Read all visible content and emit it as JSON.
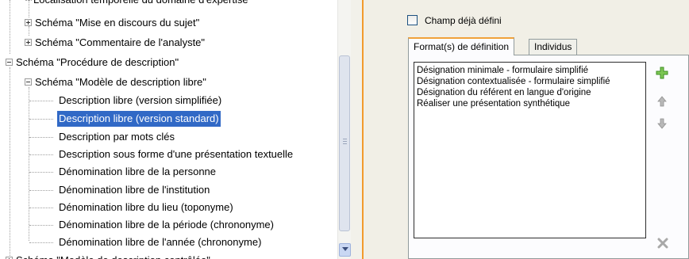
{
  "tree": {
    "top_cut_text": "Localisation temporelle du domaine d'expertise",
    "nodes": [
      {
        "label": "Schéma \"Mise en discours du sujet\"",
        "expander": "plus"
      },
      {
        "label": "Schéma \"Commentaire de l'analyste\"",
        "expander": "plus"
      },
      {
        "label": "Schéma \"Procédure de description\"",
        "expander": "minus"
      },
      {
        "label": "Schéma \"Modèle de description libre\"",
        "expander": "minus"
      },
      {
        "label": "Description libre (version simplifiée)"
      },
      {
        "label": "Description libre (version standard)",
        "selected": true
      },
      {
        "label": "Description par mots clés"
      },
      {
        "label": "Description sous forme d'une présentation textuelle"
      },
      {
        "label": "Dénomination libre de la personne"
      },
      {
        "label": "Dénomination libre de l'institution"
      },
      {
        "label": "Dénomination libre du lieu (toponyme)"
      },
      {
        "label": "Dénomination libre de la période (chrononyme)"
      },
      {
        "label": "Dénomination libre de l'année (chrononyme)"
      }
    ],
    "bottom_cut_text": "Schéma \"Modèle de description contrôlée\"",
    "icons": {
      "expand": "plus-box-icon",
      "collapse": "minus-box-icon",
      "scroll_down": "chevron-down-icon"
    }
  },
  "right": {
    "checkbox_label": "Champ déjà défini",
    "checkbox_checked": false,
    "tabs": [
      {
        "label": "Format(s) de définition",
        "active": true
      },
      {
        "label": "Individus",
        "active": false
      }
    ],
    "list_items": [
      "Désignation minimale - formulaire simplifié",
      "Désignation contextualisée - formulaire simplifié",
      "Désignation du référent en langue d'origine",
      "Réaliser une présentation synthétique"
    ],
    "buttons": {
      "add": "plus-icon",
      "move_up": "arrow-up-icon",
      "move_down": "arrow-down-icon",
      "delete": "close-icon"
    }
  },
  "colors": {
    "selection": "#3169c6",
    "accent_orange": "#f29b2d",
    "panel_bg": "#f1efe6",
    "add_green": "#5fb53b"
  }
}
